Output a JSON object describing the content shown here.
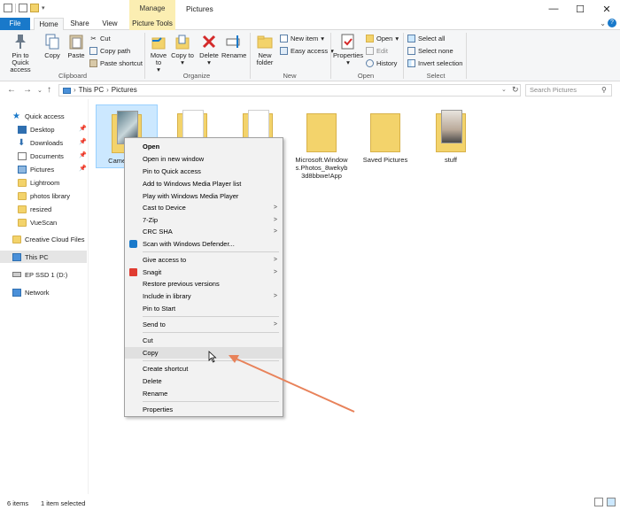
{
  "window": {
    "title": "Pictures",
    "manage_label": "Manage",
    "minimize": "—",
    "maximize": "☐",
    "close": "✕"
  },
  "tabs": [
    "File",
    "Home",
    "Share",
    "View",
    "Picture Tools"
  ],
  "ribbon": {
    "clipboard": {
      "label": "Clipboard",
      "pin": "Pin to Quick access",
      "copy": "Copy",
      "paste": "Paste",
      "cut": "Cut",
      "copy_path": "Copy path",
      "paste_shortcut": "Paste shortcut"
    },
    "organize": {
      "label": "Organize",
      "move_to": "Move to",
      "copy_to": "Copy to",
      "delete": "Delete",
      "rename": "Rename"
    },
    "new": {
      "label": "New",
      "new_folder": "New folder",
      "new_item": "New item",
      "easy_access": "Easy access"
    },
    "open": {
      "label": "Open",
      "properties": "Properties",
      "open": "Open",
      "edit": "Edit",
      "history": "History"
    },
    "select": {
      "label": "Select",
      "select_all": "Select all",
      "select_none": "Select none",
      "invert": "Invert selection"
    }
  },
  "address": {
    "this_pc": "This PC",
    "folder": "Pictures",
    "search_placeholder": "Search Pictures"
  },
  "sidebar": {
    "quick_access": "Quick access",
    "items": [
      "Desktop",
      "Downloads",
      "Documents",
      "Pictures",
      "Lightroom",
      "photos library",
      "resized",
      "VueScan"
    ],
    "creative_cloud": "Creative Cloud Files",
    "this_pc": "This PC",
    "drive": "EP SSD 1 (D:)",
    "network": "Network"
  },
  "files": [
    {
      "name": "Camera Roll"
    },
    {
      "name": ""
    },
    {
      "name": ""
    },
    {
      "name": "Microsoft.Windows.Photos_8wekyb3d8bbwe!App"
    },
    {
      "name": "Saved Pictures"
    },
    {
      "name": "stuff"
    }
  ],
  "context_menu": {
    "open": "Open",
    "open_new_window": "Open in new window",
    "pin_quick": "Pin to Quick access",
    "add_wmp": "Add to Windows Media Player list",
    "play_wmp": "Play with Windows Media Player",
    "cast": "Cast to Device",
    "zip": "7-Zip",
    "crc": "CRC SHA",
    "defender": "Scan with Windows Defender...",
    "give_access": "Give access to",
    "snagit": "Snagit",
    "restore": "Restore previous versions",
    "include_library": "Include in library",
    "pin_start": "Pin to Start",
    "send_to": "Send to",
    "cut": "Cut",
    "copy": "Copy",
    "create_shortcut": "Create shortcut",
    "delete": "Delete",
    "rename": "Rename",
    "properties": "Properties"
  },
  "status": {
    "items": "6 items",
    "selected": "1 item selected"
  },
  "colors": {
    "accent": "#1979ca",
    "manage_tab": "#fbeeb2",
    "annotation_arrow": "#e8825a"
  }
}
